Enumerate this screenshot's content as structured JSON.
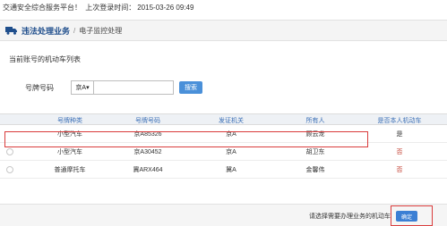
{
  "topbar": {
    "welcome": "交通安全综合服务平台！",
    "last_login_label": "上次登录时间：",
    "last_login_time": "2015-03-26 09:49"
  },
  "breadcrumb": {
    "icon": "truck-icon",
    "main": "违法处理业务",
    "separator": "/",
    "sub": "电子监控处理"
  },
  "section": {
    "title": "当前账号的机动车列表"
  },
  "search": {
    "label": "号牌号码",
    "prefix": "京A▾",
    "plate_value": "",
    "button": "搜索"
  },
  "table": {
    "headers": [
      "号牌种类",
      "号牌号码",
      "发证机关",
      "所有人",
      "是否本人机动车"
    ],
    "rows": [
      {
        "type": "小型汽车",
        "plate": "京A85326",
        "authority": "京A",
        "owner": "顾云龙",
        "self": "是"
      },
      {
        "type": "小型汽车",
        "plate": "京A30452",
        "authority": "京A",
        "owner": "胡卫东",
        "self": "否"
      },
      {
        "type": "普通摩托车",
        "plate": "冀ARX464",
        "authority": "冀A",
        "owner": "金馨伟",
        "self": "否"
      }
    ]
  },
  "footer": {
    "note": "请选择需要办理业务的机动车",
    "confirm": "确定"
  },
  "colors": {
    "accent": "#4a90d9",
    "highlight": "#d93c3c",
    "header_text": "#3b6fb6"
  }
}
